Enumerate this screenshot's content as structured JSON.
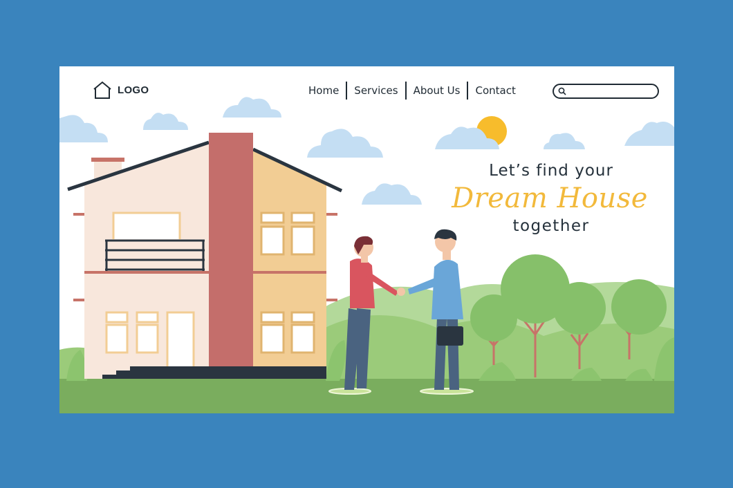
{
  "header": {
    "logo_text": "LOGO",
    "logo_icon": "house-outline-icon",
    "nav_items": [
      {
        "label": "Home"
      },
      {
        "label": "Services"
      },
      {
        "label": "About Us"
      },
      {
        "label": "Contact"
      }
    ],
    "search": {
      "icon": "search-icon",
      "placeholder": "",
      "value": ""
    }
  },
  "hero": {
    "line1": "Let’s find your",
    "line2": "Dream House",
    "line3": "together"
  },
  "colors": {
    "background": "#3a84bd",
    "accent_yellow": "#f2b93b",
    "text_dark": "#25313b",
    "cloud": "#bcd9f2",
    "grass": "#7aad5e"
  }
}
